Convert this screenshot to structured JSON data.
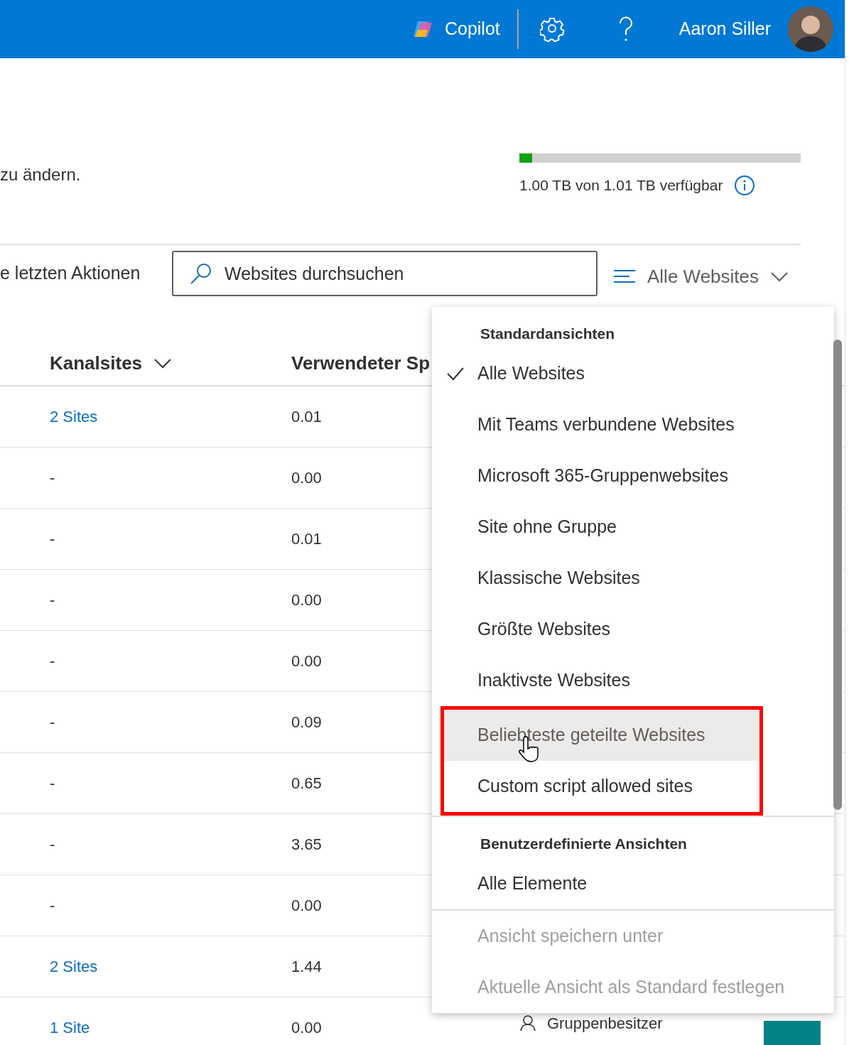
{
  "header": {
    "copilot_label": "Copilot",
    "user_name": "Aaron Siller"
  },
  "intro_text": "zu ändern.",
  "storage": {
    "level": 0.045,
    "text": "1.00 TB von 1.01 TB verfügbar"
  },
  "toolbar": {
    "recent_actions": "e letzten Aktionen",
    "search": {
      "placeholder": "Websites durchsuchen"
    },
    "view_button": "Alle Websites"
  },
  "table": {
    "columns": [
      {
        "label": "Kanalsites",
        "has_menu": true
      },
      {
        "label": "Verwendeter Sp",
        "has_menu": false
      }
    ],
    "rows": [
      {
        "channel_sites": "2 Sites",
        "link": true,
        "used": "0.01"
      },
      {
        "channel_sites": "-",
        "link": false,
        "used": "0.00"
      },
      {
        "channel_sites": "-",
        "link": false,
        "used": "0.01"
      },
      {
        "channel_sites": "-",
        "link": false,
        "used": "0.00"
      },
      {
        "channel_sites": "-",
        "link": false,
        "used": "0.00"
      },
      {
        "channel_sites": "-",
        "link": false,
        "used": "0.09"
      },
      {
        "channel_sites": "-",
        "link": false,
        "used": "0.65"
      },
      {
        "channel_sites": "-",
        "link": false,
        "used": "3.65"
      },
      {
        "channel_sites": "-",
        "link": false,
        "used": "0.00"
      },
      {
        "channel_sites": "2 Sites",
        "link": true,
        "used": "1.44"
      },
      {
        "channel_sites": "1 Site",
        "link": true,
        "used": "0.00",
        "owner": "Gruppenbesitzer"
      }
    ]
  },
  "view_menu": {
    "groups": [
      {
        "title": "Standardansichten",
        "items": [
          {
            "label": "Alle Websites",
            "selected": true,
            "hovered": false,
            "disabled": false,
            "framed": false
          },
          {
            "label": "Mit Teams verbundene Websites",
            "selected": false,
            "hovered": false,
            "disabled": false,
            "framed": false
          },
          {
            "label": "Microsoft 365-Gruppenwebsites",
            "selected": false,
            "hovered": false,
            "disabled": false,
            "framed": false
          },
          {
            "label": "Site ohne Gruppe",
            "selected": false,
            "hovered": false,
            "disabled": false,
            "framed": false
          },
          {
            "label": "Klassische Websites",
            "selected": false,
            "hovered": false,
            "disabled": false,
            "framed": false
          },
          {
            "label": "Größte Websites",
            "selected": false,
            "hovered": false,
            "disabled": false,
            "framed": false
          },
          {
            "label": "Inaktivste Websites",
            "selected": false,
            "hovered": false,
            "disabled": false,
            "framed": false
          },
          {
            "label": "Beliebteste geteilte Websites",
            "selected": false,
            "hovered": true,
            "disabled": false,
            "framed": true
          },
          {
            "label": "Custom script allowed sites",
            "selected": false,
            "hovered": false,
            "disabled": false,
            "framed": true
          }
        ]
      },
      {
        "title": "Benutzerdefinierte Ansichten",
        "items": [
          {
            "label": "Alle Elemente",
            "selected": false,
            "hovered": false,
            "disabled": false,
            "framed": false
          }
        ]
      },
      {
        "items": [
          {
            "label": "Ansicht speichern unter",
            "selected": false,
            "hovered": false,
            "disabled": true,
            "framed": false
          },
          {
            "label": "Aktuelle Ansicht als Standard festlegen",
            "selected": false,
            "hovered": false,
            "disabled": true,
            "framed": false
          }
        ]
      }
    ]
  }
}
